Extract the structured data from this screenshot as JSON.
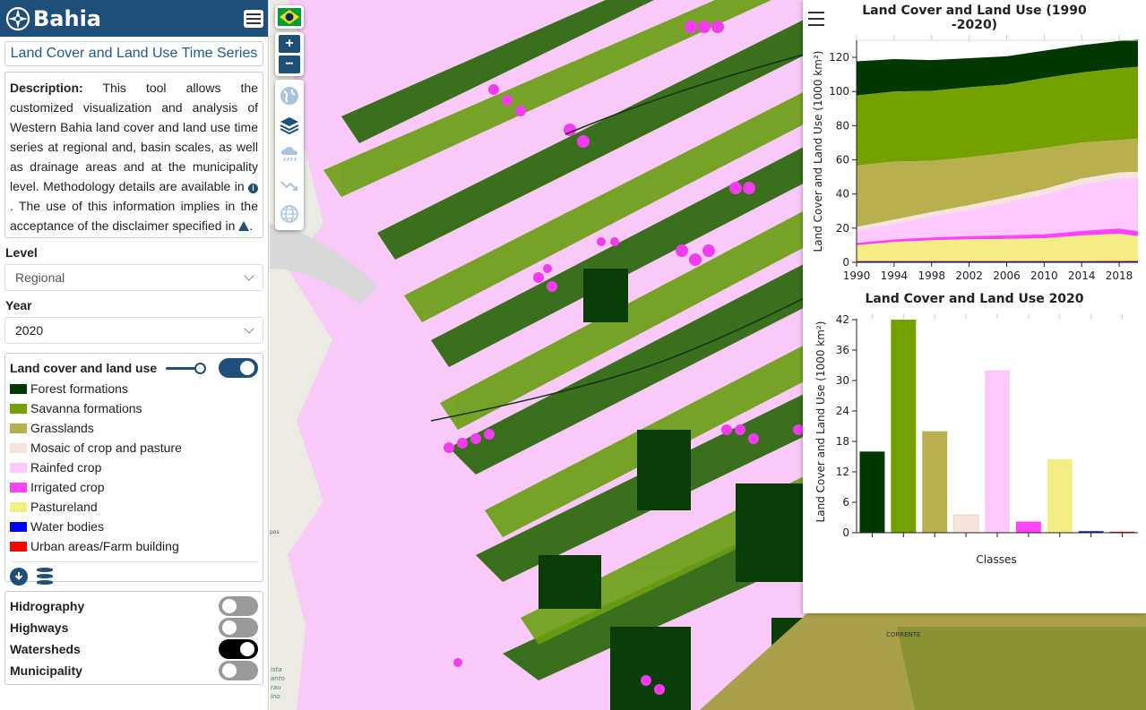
{
  "app": {
    "brand": "Bahia"
  },
  "sidebar": {
    "tool_title": "Land Cover and Land Use Time Series",
    "description": {
      "label": "Description:",
      "text1": " This tool allows the customized visualization and analysis of Western Bahia land cover and land use time series at regional and, basin scales, as well as drainage areas and at the municipality level. Methodology details are available in ",
      "text2": ". The use of this information implies in the acceptance of the disclaimer specified in ",
      "text3": "."
    },
    "level": {
      "label": "Level",
      "value": "Regional"
    },
    "year": {
      "label": "Year",
      "value": "2020"
    },
    "legend": {
      "title": "Land cover and land use",
      "opacity": 1.0,
      "enabled": true,
      "items": [
        {
          "label": "Forest formations",
          "color": "#003800"
        },
        {
          "label": "Savanna formations",
          "color": "#74a000"
        },
        {
          "label": "Grasslands",
          "color": "#b8af4f"
        },
        {
          "label": "Mosaic of crop and pasture",
          "color": "#f5e4dc"
        },
        {
          "label": "Rainfed crop",
          "color": "#ffc8fe"
        },
        {
          "label": "Irrigated crop",
          "color": "#fd43fd"
        },
        {
          "label": "Pastureland",
          "color": "#f3ee83"
        },
        {
          "label": "Water bodies",
          "color": "#0000ff"
        },
        {
          "label": "Urban areas/Farm building",
          "color": "#ff0000"
        }
      ],
      "footer_icons": [
        "download-icon",
        "database-icon"
      ]
    },
    "layers": [
      {
        "label": "Hidrography",
        "on": false
      },
      {
        "label": "Highways",
        "on": false
      },
      {
        "label": "Watersheds",
        "on": true
      },
      {
        "label": "Municipality",
        "on": false
      }
    ]
  },
  "map": {
    "zoom_in": "+",
    "zoom_out": "−",
    "labels": {
      "town": "CORRENTE",
      "small_1": "pos",
      "water_words": [
        "ista",
        "anto",
        "rau",
        "ino"
      ]
    }
  },
  "chart_data": [
    {
      "type": "area",
      "title": "Land Cover and Land Use (1990 -2020)",
      "ylabel": "Land Cover and Land Use (1000 km²)",
      "xlabel": "",
      "x_ticks": [
        "1990",
        "1994",
        "1998",
        "2002",
        "2006",
        "2010",
        "2014",
        "2018"
      ],
      "y_ticks": [
        "0",
        "20",
        "40",
        "60",
        "80",
        "100",
        "120"
      ],
      "x": [
        1990,
        1994,
        1998,
        2002,
        2006,
        2010,
        2014,
        2018,
        2020
      ],
      "ylim": [
        0,
        130
      ],
      "stacked": true,
      "series": [
        {
          "name": "Water bodies",
          "color": "#0000ff",
          "values": [
            0.5,
            0.5,
            0.5,
            0.5,
            0.5,
            0.5,
            0.5,
            0.5,
            0.5
          ]
        },
        {
          "name": "Urban areas/Farm building",
          "color": "#ff0000",
          "values": [
            0.2,
            0.2,
            0.2,
            0.2,
            0.2,
            0.2,
            0.2,
            0.3,
            0.3
          ]
        },
        {
          "name": "Pastureland",
          "color": "#f3ee83",
          "values": [
            9.5,
            11.2,
            12.2,
            12.8,
            13.0,
            13.4,
            15.0,
            16.0,
            14.5
          ]
        },
        {
          "name": "Irrigated crop",
          "color": "#fd43fd",
          "values": [
            0.5,
            0.8,
            1.0,
            1.2,
            1.4,
            1.6,
            2.0,
            2.3,
            2.2
          ]
        },
        {
          "name": "Rainfed crop",
          "color": "#ffc8fe",
          "values": [
            8,
            10,
            13,
            16,
            20,
            24,
            28,
            30,
            32
          ]
        },
        {
          "name": "Mosaic of crop and pasture",
          "color": "#f5e4dc",
          "values": [
            2.0,
            2.3,
            2.5,
            2.8,
            3.0,
            3.2,
            3.4,
            3.5,
            3.5
          ]
        },
        {
          "name": "Grasslands",
          "color": "#b8af4f",
          "values": [
            36,
            34,
            30,
            28,
            26,
            24,
            21,
            19,
            19.5
          ]
        },
        {
          "name": "Savanna formations",
          "color": "#74a000",
          "values": [
            41,
            41,
            41,
            41,
            40,
            41,
            41,
            42,
            42
          ]
        },
        {
          "name": "Forest formations",
          "color": "#003800",
          "values": [
            20,
            19,
            18,
            17,
            16.5,
            16,
            16,
            16,
            16
          ]
        }
      ]
    },
    {
      "type": "bar",
      "title": "Land Cover and Land Use 2020",
      "xlabel": "Classes",
      "ylabel": "Land Cover and Land Use (1000 km²)",
      "y_ticks": [
        "0",
        "6",
        "12",
        "18",
        "24",
        "30",
        "36",
        "42"
      ],
      "ylim": [
        0,
        42
      ],
      "categories": [
        "Forest formations",
        "Savanna formations",
        "Grasslands",
        "Mosaic of crop and pasture",
        "Rainfed crop",
        "Irrigated crop",
        "Pastureland",
        "Water bodies",
        "Urban areas/Farm building"
      ],
      "values": [
        16,
        42,
        20,
        3.5,
        32,
        2.2,
        14.5,
        0.3,
        0.2
      ],
      "colors": [
        "#003800",
        "#74a000",
        "#b8af4f",
        "#f5e4dc",
        "#ffc8fe",
        "#fd43fd",
        "#f3ee83",
        "#0000ff",
        "#ff0000"
      ]
    }
  ]
}
